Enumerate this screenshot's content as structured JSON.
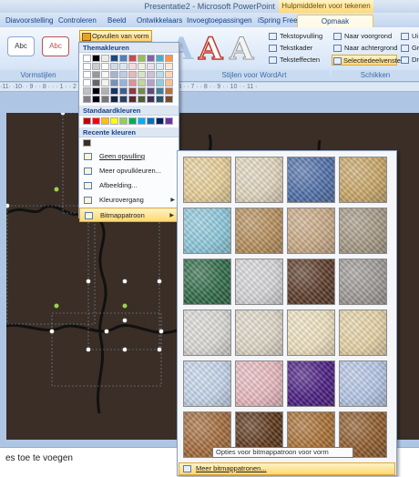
{
  "window": {
    "title": "Presentatie2 - Microsoft PowerPoint",
    "context_tab": "Hulpmiddelen voor tekenen"
  },
  "tabs": [
    "Diavoorstelling",
    "Controleren",
    "Beeld",
    "Ontwikkelaars",
    "Invoegtoepassingen",
    "iSpring Free",
    "Opmaak"
  ],
  "ribbon": {
    "shape_style_labels": [
      "Abc",
      "Abc"
    ],
    "fill_button": "Opvullen van vorm",
    "wordart_letter": "A",
    "text_fill": "Tekstopvulling",
    "text_outline": "Tekstkader",
    "text_effects": "Teksteffecten",
    "bring_forward": "Naar voorgrond",
    "send_backward": "Naar achtergrond",
    "selection_pane": "Selectiedeelvenster",
    "partial": [
      "Ui",
      "Gr",
      "Dr"
    ],
    "groups": {
      "shape_styles": "Vormstijlen",
      "wordart": "Stijlen voor WordArt",
      "arrange": "Schikken"
    }
  },
  "ruler_text": "·11· ·10· · 9 · · 8 ·  ·  · 1 · · 2 · · 1 · · 0 · · 1 · · 2 · · 3 · · 4 · · 5 · · 6 · · 7 · · 8 · · 9 · · 10 · · 11 ·",
  "notes_text": "es toe te voegen",
  "fill_menu": {
    "theme_header": "Themakleuren",
    "theme_top": [
      "#ffffff",
      "#000000",
      "#eeece1",
      "#1f497d",
      "#4f81bd",
      "#c0504d",
      "#9bbb59",
      "#8064a2",
      "#4bacc6",
      "#f79646"
    ],
    "standard_header": "Standaardkleuren",
    "standard": [
      "#c00000",
      "#ff0000",
      "#ffc000",
      "#ffff00",
      "#92d050",
      "#00b050",
      "#00b0f0",
      "#0070c0",
      "#002060",
      "#7030a0"
    ],
    "recent_header": "Recente kleuren",
    "recent": [
      "#3a2e26"
    ],
    "items": [
      {
        "label": "Geen opvulling"
      },
      {
        "label": "Meer opvulkleuren..."
      },
      {
        "label": "Afbeelding..."
      },
      {
        "label": "Kleurovergang"
      },
      {
        "label": "Bitmappatroon"
      }
    ]
  },
  "textures": [
    {
      "name": "papyrus",
      "color": "#e8cf98"
    },
    {
      "name": "canvas",
      "color": "#e2d6bf"
    },
    {
      "name": "denim",
      "color": "#4f6fa8"
    },
    {
      "name": "woven-mat",
      "color": "#c9a768"
    },
    {
      "name": "water-droplets",
      "color": "#8ec9dc"
    },
    {
      "name": "paper-bag",
      "color": "#b68f5c"
    },
    {
      "name": "fish-fossil",
      "color": "#c9aa86"
    },
    {
      "name": "sand",
      "color": "#a69a86"
    },
    {
      "name": "green-marble",
      "color": "#2f6a47"
    },
    {
      "name": "white-marble",
      "color": "#d7d7d9"
    },
    {
      "name": "brown-marble",
      "color": "#5b3a28"
    },
    {
      "name": "granite",
      "color": "#9e9a97"
    },
    {
      "name": "newsprint",
      "color": "#dcdad6"
    },
    {
      "name": "recycled-paper",
      "color": "#e0d8c8"
    },
    {
      "name": "parchment",
      "color": "#efe1c0"
    },
    {
      "name": "stationery",
      "color": "#e6d3a6"
    },
    {
      "name": "blue-tissue-paper",
      "color": "#c6d6ec"
    },
    {
      "name": "pink-tissue-paper",
      "color": "#e8b9bf"
    },
    {
      "name": "purple-mesh",
      "color": "#4a1d82"
    },
    {
      "name": "bouquet",
      "color": "#b5c6e6"
    },
    {
      "name": "cork",
      "color": "#a36b3b"
    },
    {
      "name": "walnut",
      "color": "#5a3316"
    },
    {
      "name": "oak",
      "color": "#a86e32"
    },
    {
      "name": "medium-wood",
      "color": "#8e5a2a"
    }
  ],
  "tooltip": "Opties voor bitmappatroon voor vorm",
  "more_textures": "Meer bitmappatronen..."
}
